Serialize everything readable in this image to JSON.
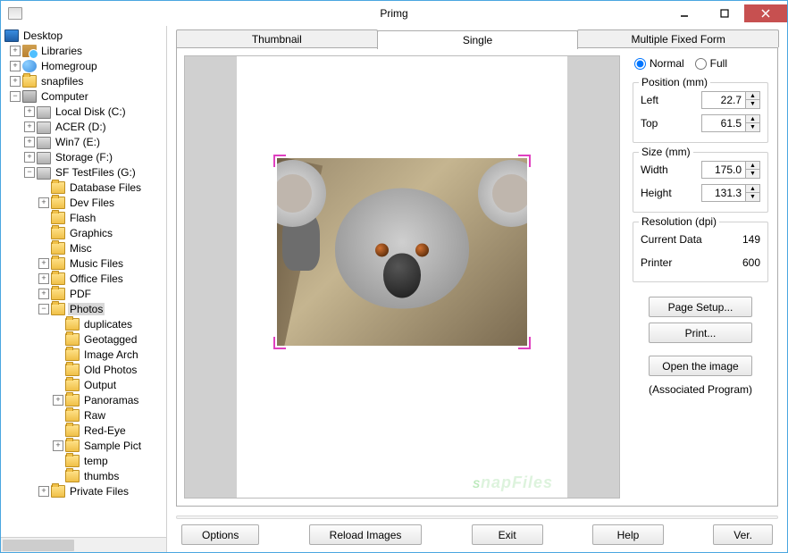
{
  "window": {
    "title": "Primg"
  },
  "tree": {
    "root": "Desktop",
    "libraries": "Libraries",
    "homegroup": "Homegroup",
    "snapfiles": "snapfiles",
    "computer": "Computer",
    "drives": {
      "c": "Local Disk (C:)",
      "d": "ACER (D:)",
      "e": "Win7 (E:)",
      "f": "Storage (F:)",
      "g": "SF TestFiles (G:)"
    },
    "g_children": {
      "database": "Database Files",
      "dev": "Dev Files",
      "flash": "Flash",
      "graphics": "Graphics",
      "misc": "Misc",
      "music": "Music Files",
      "office": "Office Files",
      "pdf": "PDF",
      "photos": "Photos",
      "private": "Private Files"
    },
    "photos_children": {
      "duplicates": "duplicates",
      "geotagged": "Geotagged",
      "imagearch": "Image Arch",
      "oldphotos": "Old Photos",
      "output": "Output",
      "panoramas": "Panoramas",
      "raw": "Raw",
      "redeye": "Red-Eye",
      "samplepict": "Sample Pict",
      "temp": "temp",
      "thumbs": "thumbs"
    }
  },
  "tabs": {
    "thumbnail": "Thumbnail",
    "single": "Single",
    "multiple": "Multiple Fixed Form"
  },
  "mode": {
    "normal": "Normal",
    "full": "Full"
  },
  "position": {
    "legend": "Position (mm)",
    "left_label": "Left",
    "left_value": "22.7",
    "top_label": "Top",
    "top_value": "61.5"
  },
  "size": {
    "legend": "Size (mm)",
    "width_label": "Width",
    "width_value": "175.0",
    "height_label": "Height",
    "height_value": "131.3"
  },
  "resolution": {
    "legend": "Resolution (dpi)",
    "current_label": "Current Data",
    "current_value": "149",
    "printer_label": "Printer",
    "printer_value": "600"
  },
  "buttons": {
    "page_setup": "Page Setup...",
    "print": "Print...",
    "open_image": "Open the image",
    "assoc": "(Associated Program)",
    "options": "Options",
    "reload": "Reload Images",
    "exit": "Exit",
    "help": "Help",
    "ver": "Ver."
  },
  "watermark": "SnapFiles"
}
